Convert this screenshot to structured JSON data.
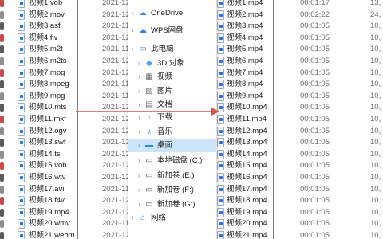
{
  "left_files": [
    {
      "name": "视频1.vob",
      "date": "2021-12"
    },
    {
      "name": "视频2.mov",
      "date": "2021-12"
    },
    {
      "name": "视频3.asf",
      "date": "2021-11"
    },
    {
      "name": "视频4.flv",
      "date": "2021-12"
    },
    {
      "name": "视频5.m2t",
      "date": "2021-11"
    },
    {
      "name": "视频6.m2ts",
      "date": "2021-12"
    },
    {
      "name": "视频7.mpg",
      "date": "2021-12"
    },
    {
      "name": "视频8.mpeg",
      "date": "2021-11"
    },
    {
      "name": "视频9.mpg",
      "date": "2021-11"
    },
    {
      "name": "视频10.mts",
      "date": "2021-12"
    },
    {
      "name": "视频11.mxf",
      "date": "2021-12"
    },
    {
      "name": "视频12.ogv",
      "date": "2021-12"
    },
    {
      "name": "视频13.swf",
      "date": "2021-12"
    },
    {
      "name": "视频14.ts",
      "date": "2021-12"
    },
    {
      "name": "视频15.vob",
      "date": "2021-12"
    },
    {
      "name": "视频16.wtv",
      "date": "2021-12"
    },
    {
      "name": "视频17.avi",
      "date": "2021-11"
    },
    {
      "name": "视频18.f4v",
      "date": "2021-12"
    },
    {
      "name": "视频19.mp4",
      "date": "2021-12"
    },
    {
      "name": "视频20.wmv",
      "date": "2021-11"
    },
    {
      "name": "视频21.webm",
      "date": "2021-12"
    }
  ],
  "nav": [
    {
      "label": "OneDrive",
      "icon": "cloud-icon"
    },
    {
      "label": "WPS网盘",
      "icon": "wps-cloud-icon"
    },
    {
      "label": "此电脑",
      "icon": "computer-icon"
    },
    {
      "label": "3D 对象",
      "icon": "3d-objects-icon"
    },
    {
      "label": "视频",
      "icon": "video-folder-icon"
    },
    {
      "label": "图片",
      "icon": "pictures-folder-icon"
    },
    {
      "label": "文档",
      "icon": "documents-folder-icon"
    },
    {
      "label": "下载",
      "icon": "download-icon"
    },
    {
      "label": "音乐",
      "icon": "music-icon"
    },
    {
      "label": "桌面",
      "icon": "desktop-icon"
    },
    {
      "label": "本地磁盘 (C:)",
      "icon": "drive-icon"
    },
    {
      "label": "新加卷 (E:)",
      "icon": "drive-icon"
    },
    {
      "label": "新加卷 (F:)",
      "icon": "drive-icon"
    },
    {
      "label": "新加卷 (G:)",
      "icon": "drive-icon"
    },
    {
      "label": "网络",
      "icon": "network-icon"
    }
  ],
  "right_files": [
    {
      "name": "视频1.mp4",
      "duration": "00:01:17",
      "size": "13,"
    },
    {
      "name": "视频2.mp4",
      "duration": "00:02:22",
      "size": "24,"
    },
    {
      "name": "视频3.mp4",
      "duration": "00:01:05",
      "size": "10,"
    },
    {
      "name": "视频4.mp4",
      "duration": "00:01:05",
      "size": "10,"
    },
    {
      "name": "视频5.mp4",
      "duration": "00:01:05",
      "size": "10,"
    },
    {
      "name": "视频6.mp4",
      "duration": "00:01:05",
      "size": "10,"
    },
    {
      "name": "视频7.mp4",
      "duration": "00:01:05",
      "size": "10,"
    },
    {
      "name": "视频8.mp4",
      "duration": "00:01:05",
      "size": "10,"
    },
    {
      "name": "视频9.mp4",
      "duration": "00:01:05",
      "size": "10,"
    },
    {
      "name": "视频10.mp4",
      "duration": "00:01:05",
      "size": "10,"
    },
    {
      "name": "视频11.mp4",
      "duration": "00:01:05",
      "size": "10,"
    },
    {
      "name": "视频12.mp4",
      "duration": "00:01:05",
      "size": "10,"
    },
    {
      "name": "视频13.mp4",
      "duration": "00:01:05",
      "size": "10,"
    },
    {
      "name": "视频14.mp4",
      "duration": "00:01:05",
      "size": "10,"
    },
    {
      "name": "视频15.mp4",
      "duration": "00:01:05",
      "size": "10,"
    },
    {
      "name": "视频16.mp4",
      "duration": "00:01:05",
      "size": "10,"
    },
    {
      "name": "视频17.mp4",
      "duration": "00:01:05",
      "size": "10,"
    },
    {
      "name": "视频18.mp4",
      "duration": "00:01:05",
      "size": "10,"
    },
    {
      "name": "视频19.mp4",
      "duration": "00:01:05",
      "size": "10,"
    },
    {
      "name": "视频20.mp4",
      "duration": "00:01:05",
      "size": "10,"
    },
    {
      "name": "视频21.mp4",
      "duration": "00:01:05",
      "size": "10,"
    }
  ],
  "colors": {
    "selection": "#cce4f7",
    "annotation": "#d9534f",
    "file_icon": "#2f6fd6"
  }
}
